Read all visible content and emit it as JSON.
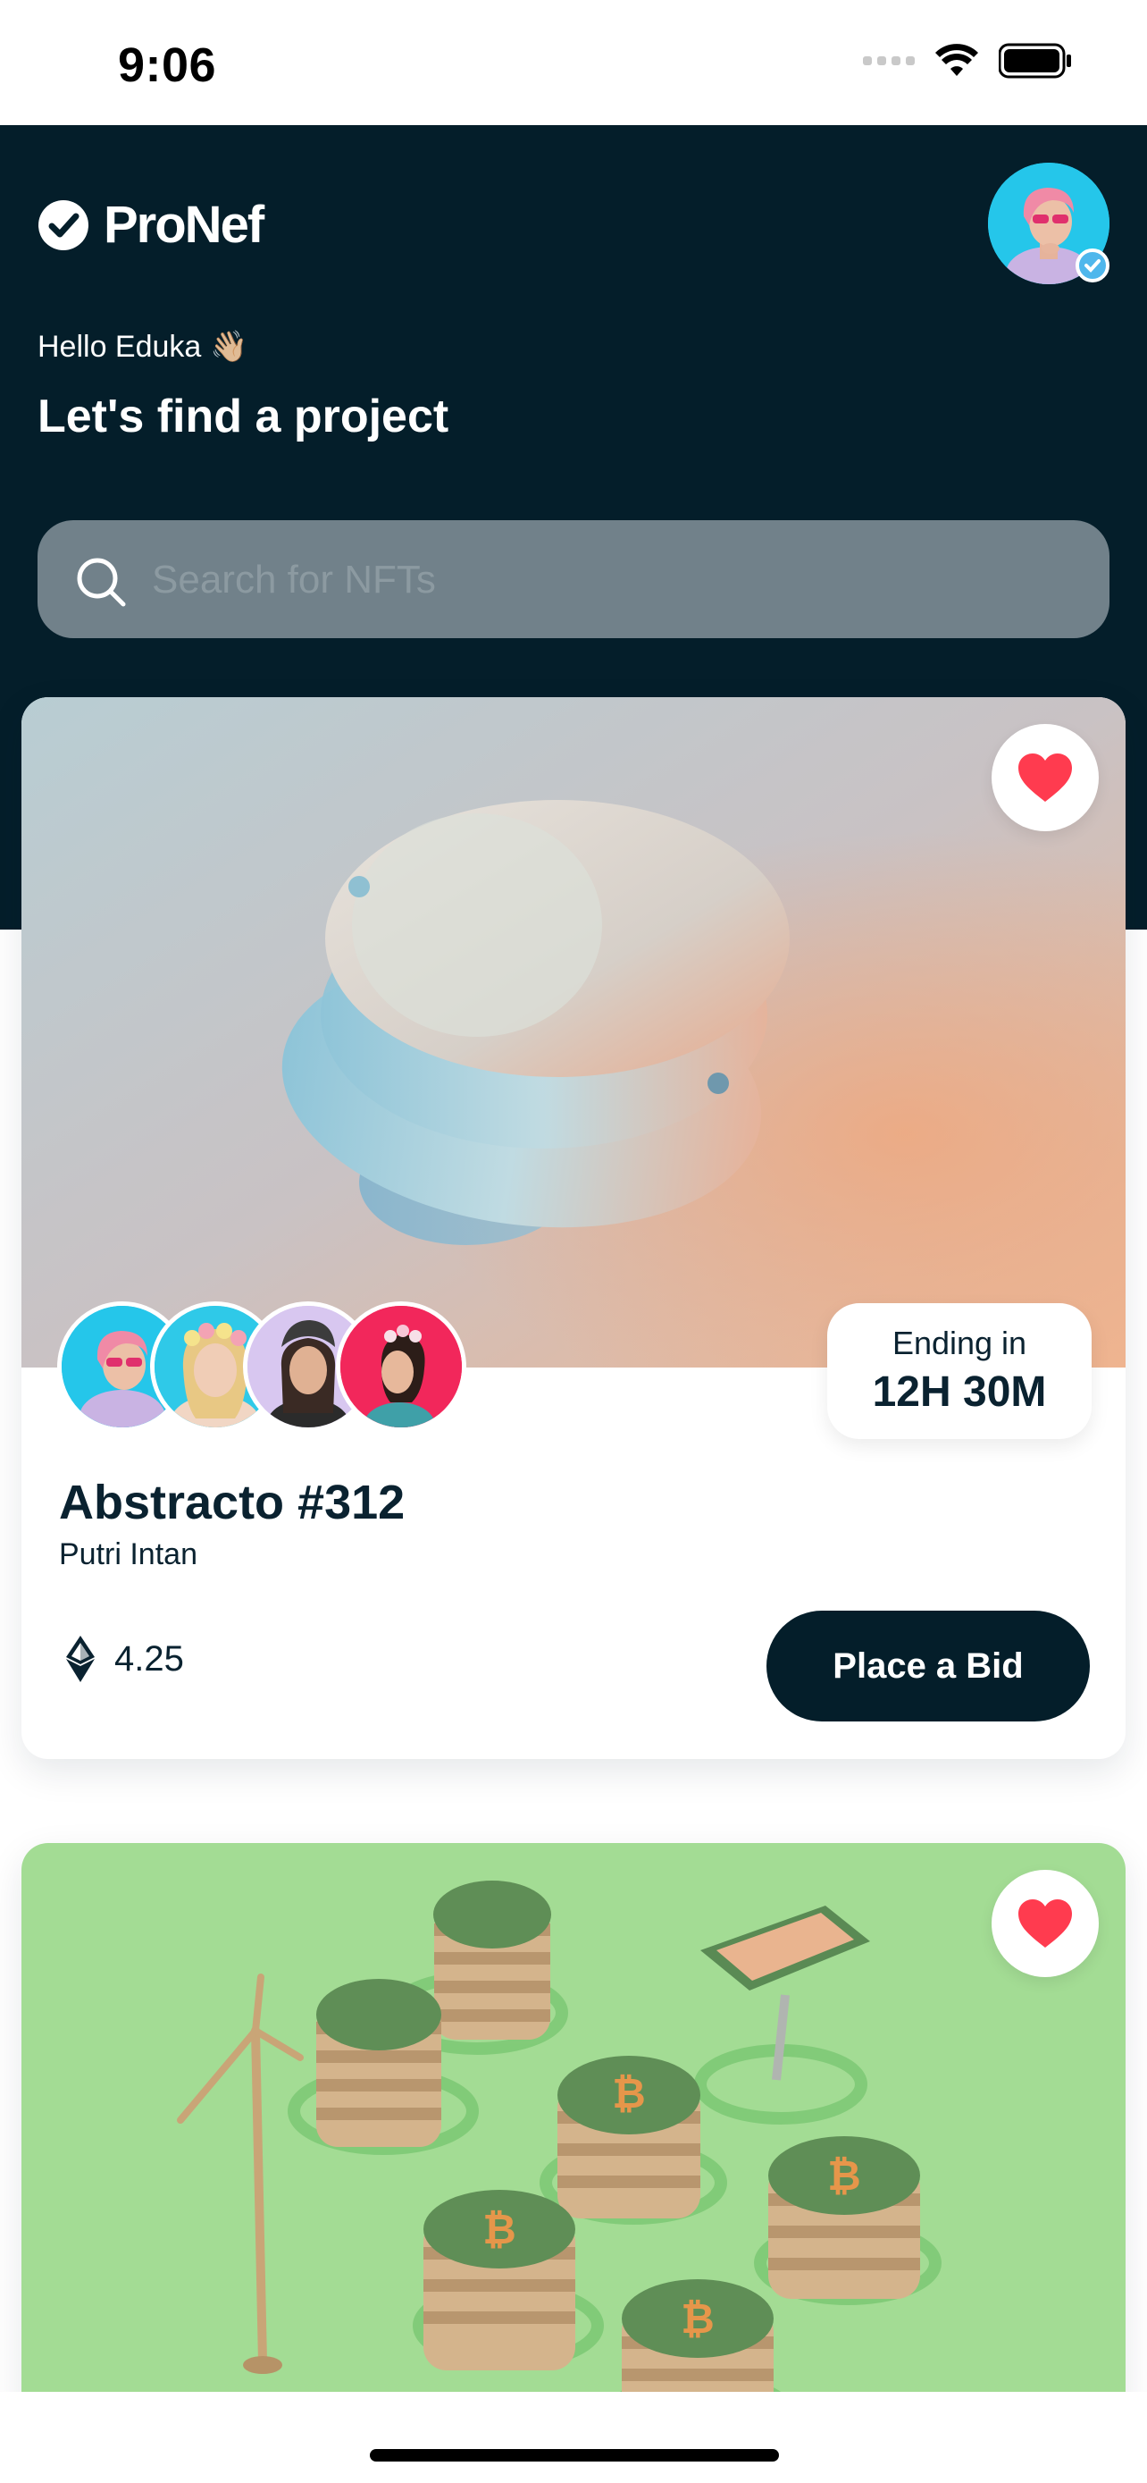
{
  "status_bar": {
    "time": "9:06"
  },
  "header": {
    "logo_text": "ProNef",
    "greeting": "Hello Eduka",
    "greeting_emoji": "👋🏼",
    "headline": "Let's find a project",
    "search": {
      "placeholder": "Search for NFTs",
      "icon": "search-icon"
    }
  },
  "colors": {
    "header_bg": "#041e2a",
    "accent_dark": "#041e2a",
    "like_red": "#ff3b4f",
    "search_bg": "#71818a"
  },
  "cards": [
    {
      "title": "Abstracto #312",
      "creator": "Putri Intan",
      "ending_label": "Ending in",
      "ending_value": "12H 30M",
      "price": "4.25",
      "price_icon": "ethereum-icon",
      "bid_label": "Place a Bid",
      "liked": true
    },
    {
      "liked": true
    }
  ]
}
